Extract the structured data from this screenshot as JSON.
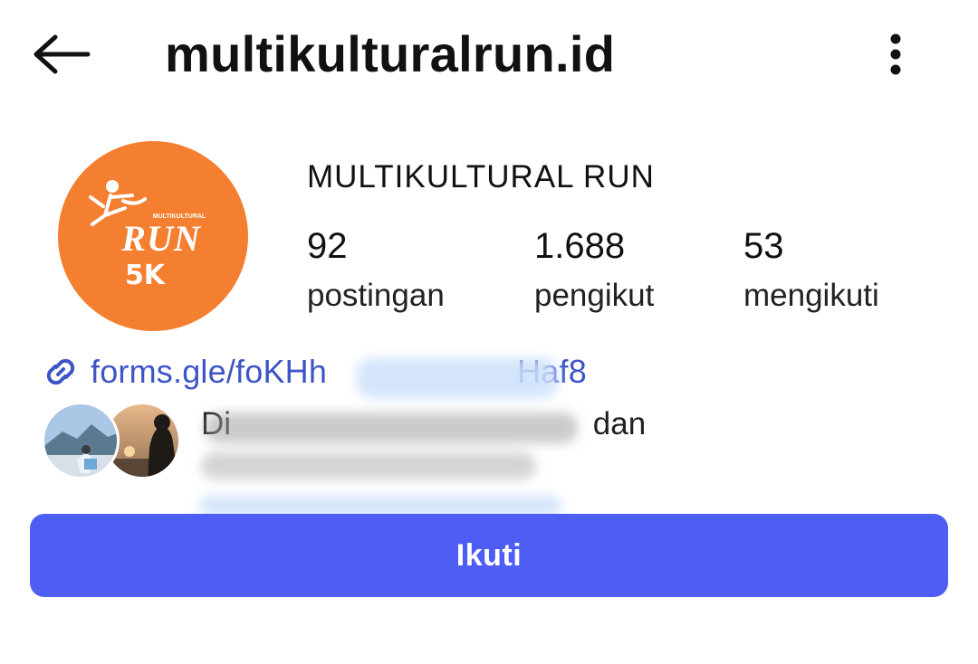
{
  "header": {
    "back_icon": "arrow-left-icon",
    "username": "multikulturalrun.id",
    "more_icon": "more-vertical-icon"
  },
  "profile": {
    "display_name": "MULTIKULTURAL RUN",
    "avatar": {
      "small_text": "MULTIKULTURAL",
      "logo_text": "RUN",
      "distance": "5K",
      "background": "#f57f31"
    },
    "stats": [
      {
        "value": "92",
        "label": "postingan"
      },
      {
        "value": "1.688",
        "label": "pengikut"
      },
      {
        "value": "53",
        "label": "mengikuti"
      }
    ]
  },
  "link": {
    "icon": "link-icon",
    "text_visible_start": "forms.gle/foKHh",
    "text_visible_end": "Haf8",
    "color": "#3d55c7"
  },
  "followed_by": {
    "prefix": "Di",
    "suffix": "dan"
  },
  "actions": {
    "follow_label": "Ikuti",
    "follow_color": "#4e5ef5"
  }
}
